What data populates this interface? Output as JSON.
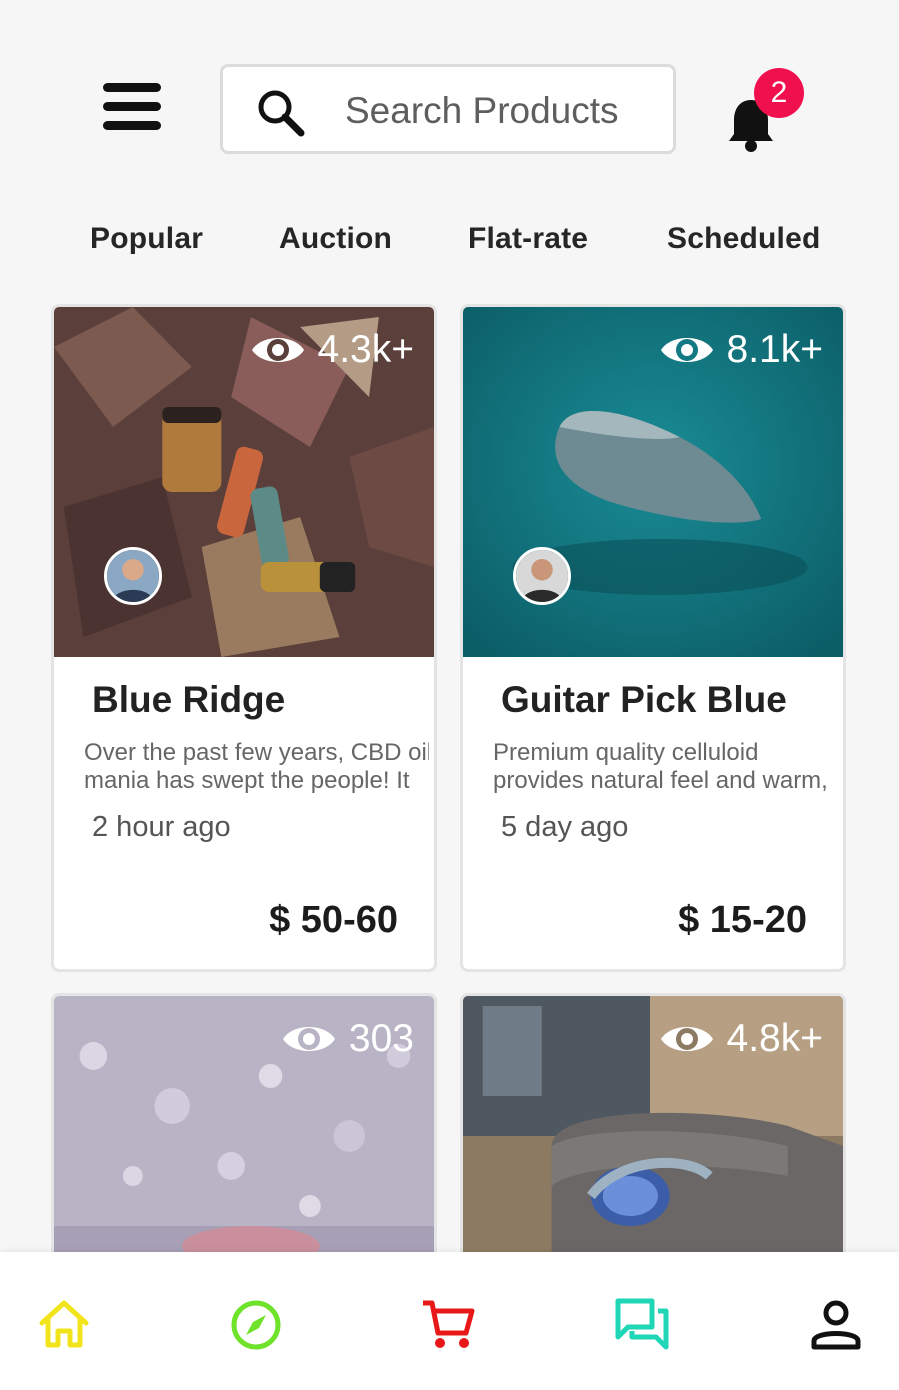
{
  "header": {
    "search_placeholder": "Search Products",
    "notification_count": "2"
  },
  "tabs": [
    {
      "label": "Popular"
    },
    {
      "label": "Auction"
    },
    {
      "label": "Flat-rate"
    },
    {
      "label": "Scheduled"
    }
  ],
  "products": [
    {
      "views": "4.3k+",
      "title": "Blue Ridge",
      "desc_line1": "Over the past few years, CBD oil",
      "desc_line2": "mania has swept the people! It",
      "time": "2 hour ago",
      "price": "$ 50-60"
    },
    {
      "views": "8.1k+",
      "title": "Guitar Pick Blue",
      "desc_line1": "Premium quality celluloid",
      "desc_line2": "provides natural feel and warm,",
      "time": "5 day ago",
      "price": "$ 15-20"
    },
    {
      "views": "303"
    },
    {
      "views": "4.8k+"
    }
  ],
  "bottom_nav": [
    {
      "icon": "home-icon",
      "color": "#f2e41b"
    },
    {
      "icon": "compass-icon",
      "color": "#6fe22a"
    },
    {
      "icon": "cart-icon",
      "color": "#e81818"
    },
    {
      "icon": "chat-icon",
      "color": "#1fd6b7"
    },
    {
      "icon": "profile-icon",
      "color": "#111111"
    }
  ],
  "colors": {
    "badge": "#f0104e",
    "background": "#f6f6f6"
  }
}
